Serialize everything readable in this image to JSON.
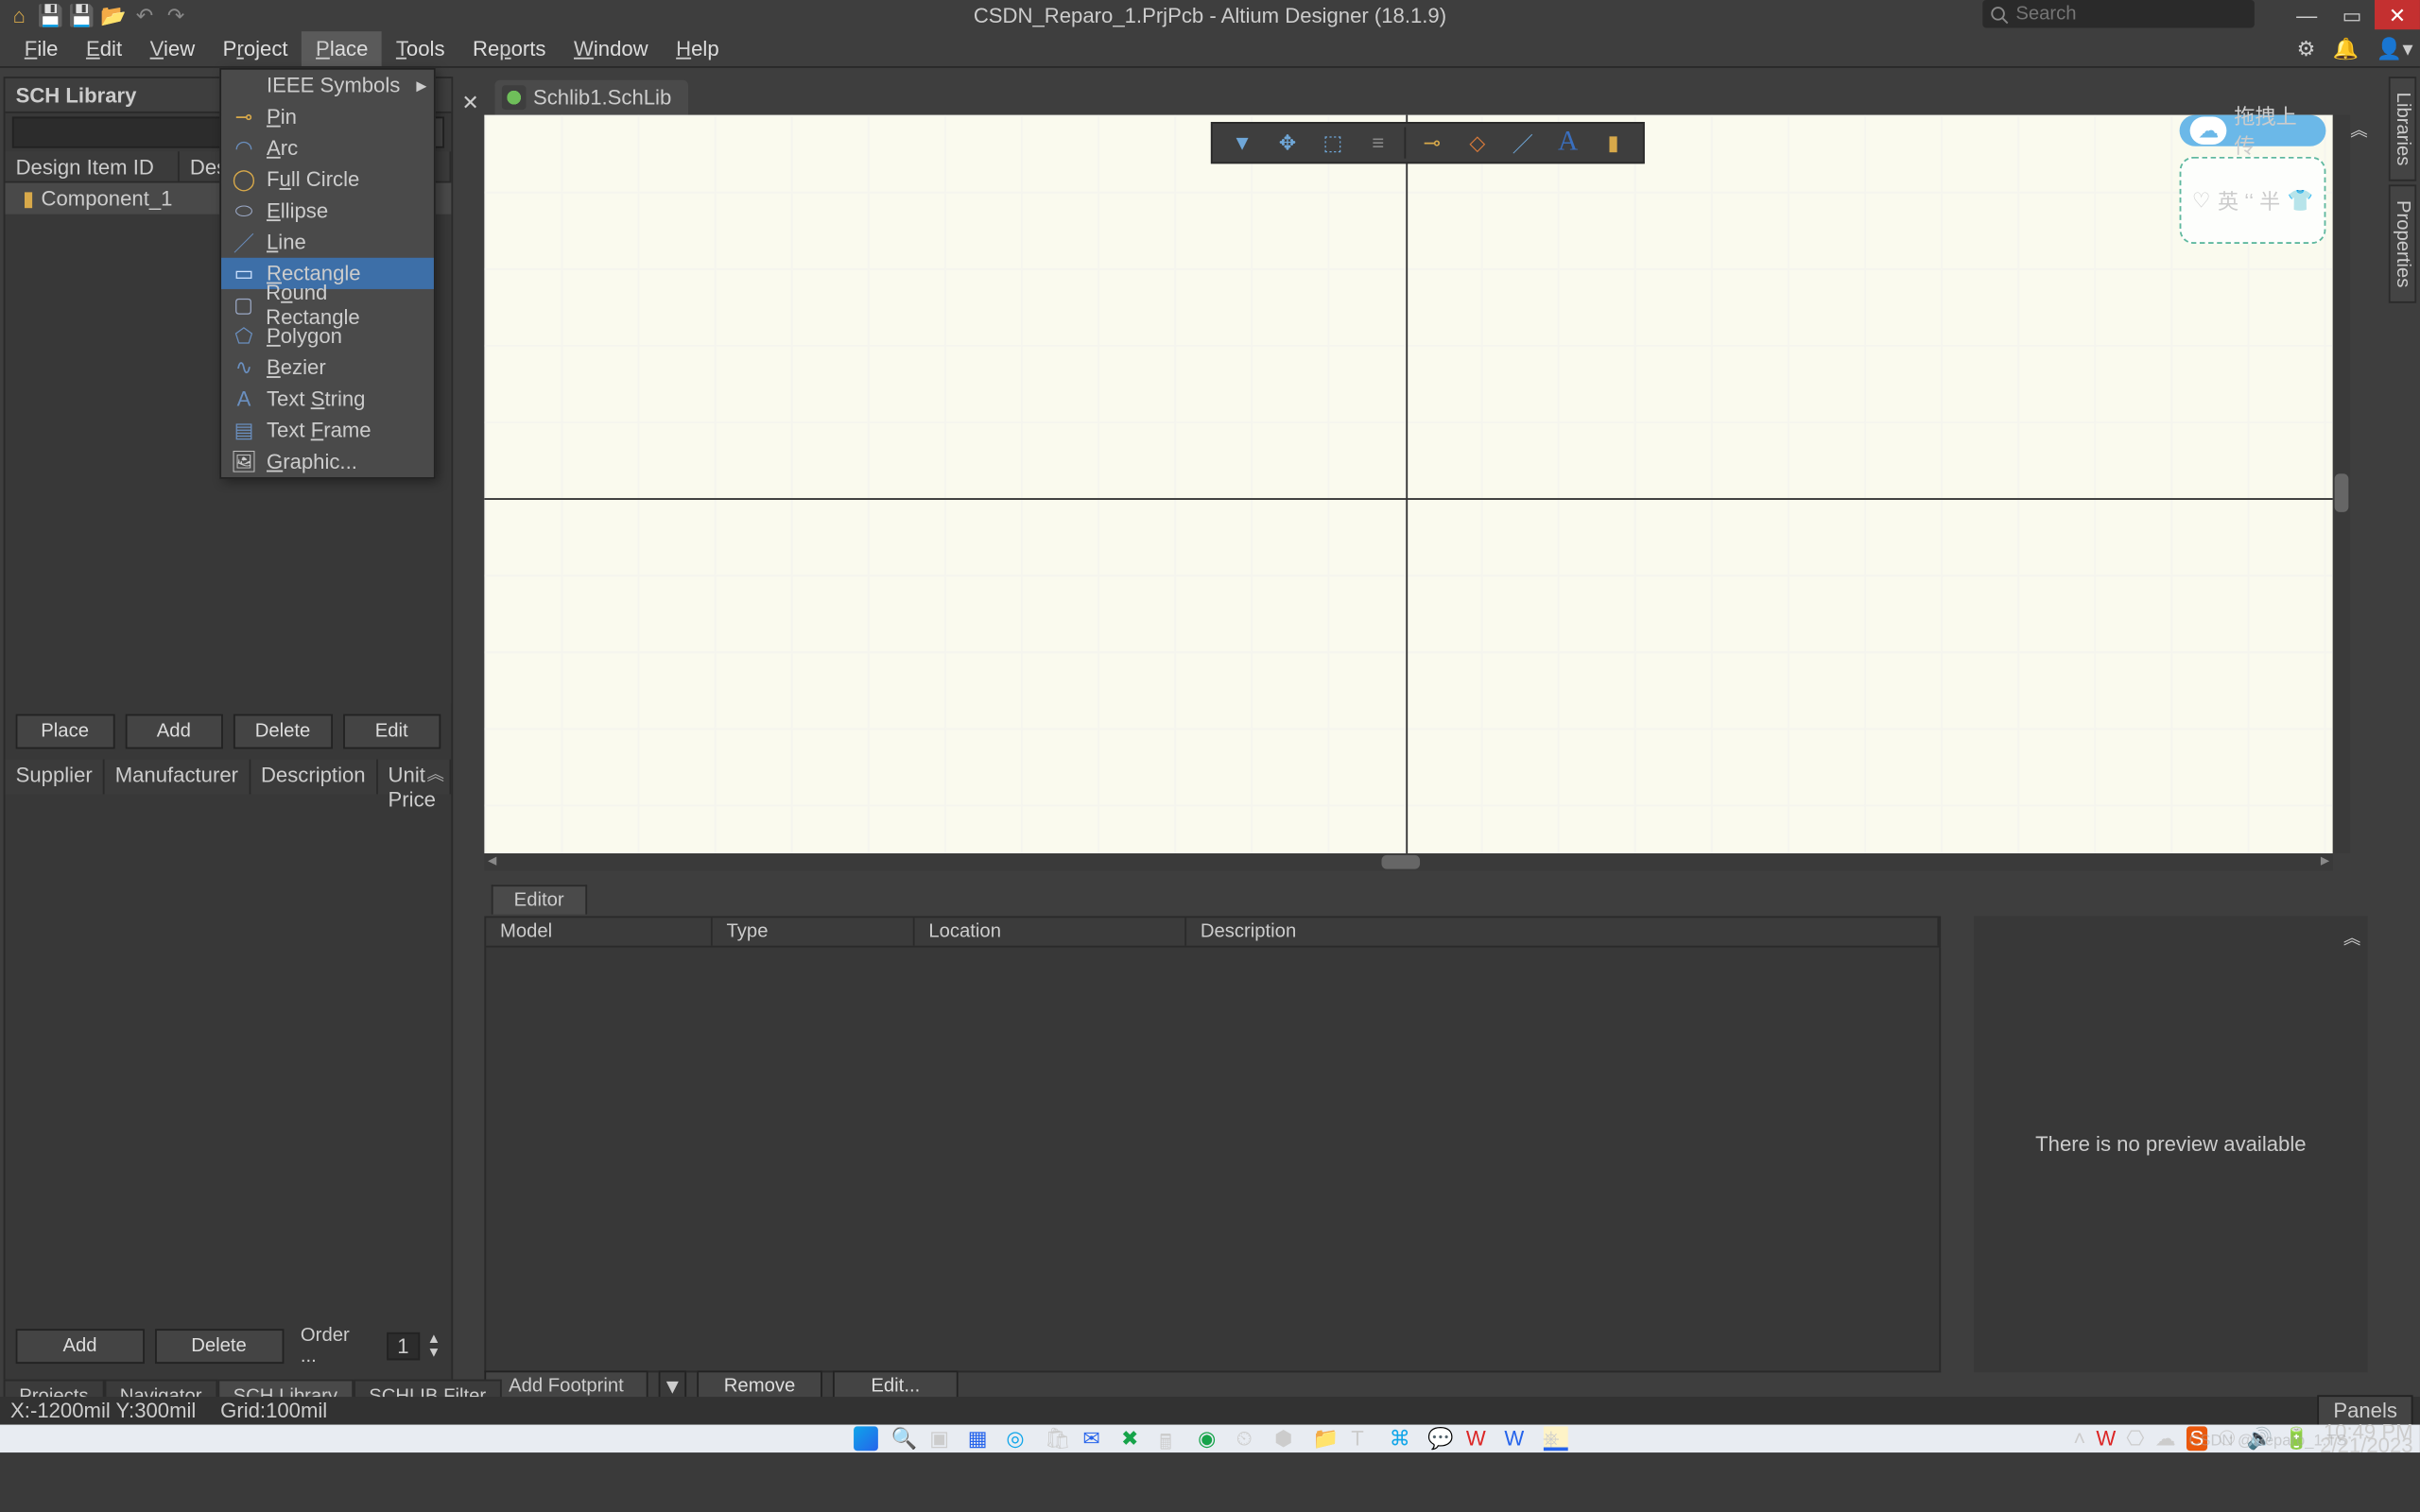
{
  "title": "CSDN_Reparo_1.PrjPcb - Altium Designer (18.1.9)",
  "search": {
    "placeholder": "Search"
  },
  "menus": [
    "File",
    "Edit",
    "View",
    "Project",
    "Place",
    "Tools",
    "Reports",
    "Window",
    "Help"
  ],
  "open_menu_index": 4,
  "place_menu": {
    "items": [
      {
        "label": "IEEE Symbols",
        "sub": true
      },
      {
        "label": "Pin",
        "u": 0
      },
      {
        "label": "Arc",
        "u": 0
      },
      {
        "label": "Full Circle",
        "u": 1
      },
      {
        "label": "Ellipse",
        "u": 0
      },
      {
        "label": "Line",
        "u": 0
      },
      {
        "label": "Rectangle",
        "u": 0,
        "hi": true
      },
      {
        "label": "Round Rectangle",
        "u": 1
      },
      {
        "label": "Polygon",
        "u": 0
      },
      {
        "label": "Bezier",
        "u": 0
      },
      {
        "label": "Text String",
        "u": 5
      },
      {
        "label": "Text Frame",
        "u": 5
      },
      {
        "label": "Graphic...",
        "u": 0
      }
    ]
  },
  "left": {
    "title": "SCH Library",
    "filter_dots": "...",
    "col1": "Design Item ID",
    "col2": "Des",
    "component": "Component_1",
    "btns": [
      "Place",
      "Add",
      "Delete",
      "Edit"
    ],
    "sup_cols": [
      "Supplier",
      "Manufacturer",
      "Description",
      "Unit Price"
    ],
    "btns2": [
      "Add",
      "Delete"
    ],
    "order_label": "Order ...",
    "order_val": "1"
  },
  "left_tabs": [
    "Projects",
    "Navigator",
    "SCH Library",
    "SCHLIB Filter"
  ],
  "active_left_tab": 2,
  "doc_tab": "Schlib1.SchLib",
  "dock": [
    "Libraries",
    "Properties"
  ],
  "sticker": {
    "btn": "拖拽上传",
    "card": "英 ʻʻ 半"
  },
  "editor_tab": "Editor",
  "low_cols": [
    "Model",
    "Type",
    "Location",
    "Description"
  ],
  "preview_text": "There is no preview available",
  "low_btns": {
    "add": "Add Footprint",
    "remove": "Remove",
    "edit": "Edit..."
  },
  "status": {
    "coords": "X:-1200mil Y:300mil",
    "grid": "Grid:100mil",
    "panels": "Panels"
  },
  "clock": {
    "time": "10:49 PM",
    "date": "2/21/2023"
  },
  "watermark": "CSDN @Reparo_1.TS"
}
